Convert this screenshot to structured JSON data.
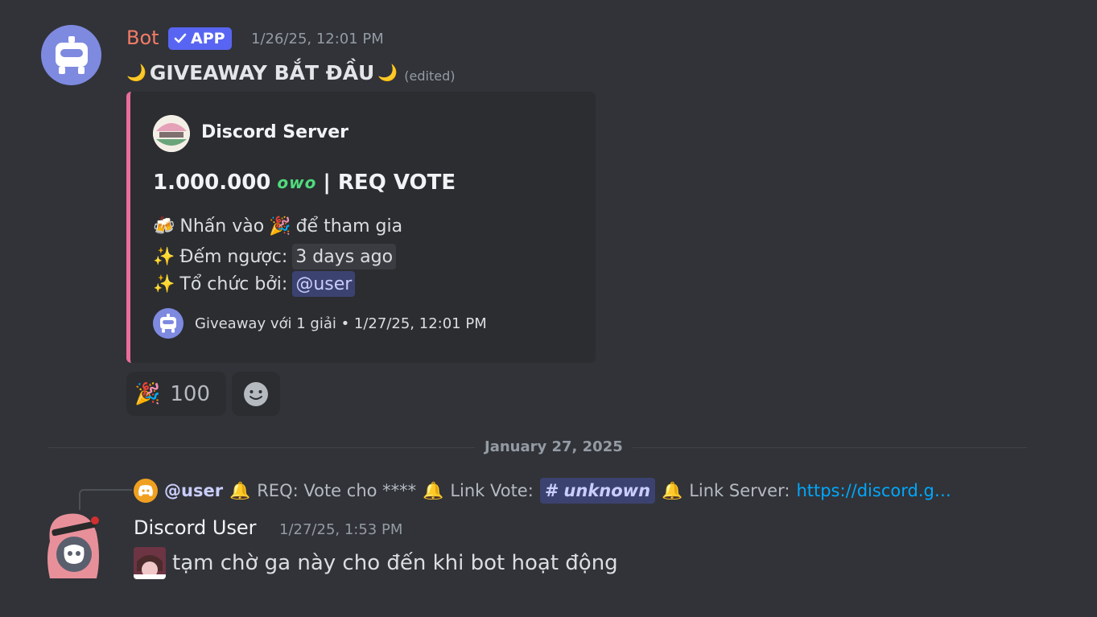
{
  "message1": {
    "author": "Bot",
    "app_tag": "APP",
    "timestamp": "1/26/25, 12:01 PM",
    "title": "GIVEAWAY BẮT ĐẦU",
    "edited": "(edited)",
    "embed": {
      "author_name": "Discord Server",
      "title_prefix": "1.000.000",
      "title_owo": "owo",
      "title_suffix": "| REQ VOTE",
      "line1_a": "Nhấn vào",
      "line1_b": "để tham gia",
      "line2_label": "Đếm ngược:",
      "line2_value": "3 days ago",
      "line3_label": "Tổ chức bởi:",
      "line3_value": "@user",
      "footer": "Giveaway với 1 giải • 1/27/25, 12:01 PM"
    },
    "reaction_count": "100"
  },
  "divider_date": "January 27, 2025",
  "message2": {
    "reply": {
      "user": "@user",
      "req": "REQ: Vote cho ****",
      "link_vote_label": "Link Vote:",
      "channel": "unknown",
      "link_server_label": "Link Server:",
      "link_server_url": "https://discord.g…"
    },
    "author": "Discord User",
    "timestamp": "1/27/25, 1:53 PM",
    "text": "tạm chờ ga này cho đến khi bot hoạt động"
  },
  "colors": {
    "background": "#313338",
    "embed_border": "#eb6c9a",
    "bot_name": "#f47b67",
    "app_tag": "#5865f2",
    "link": "#00a8fc"
  }
}
